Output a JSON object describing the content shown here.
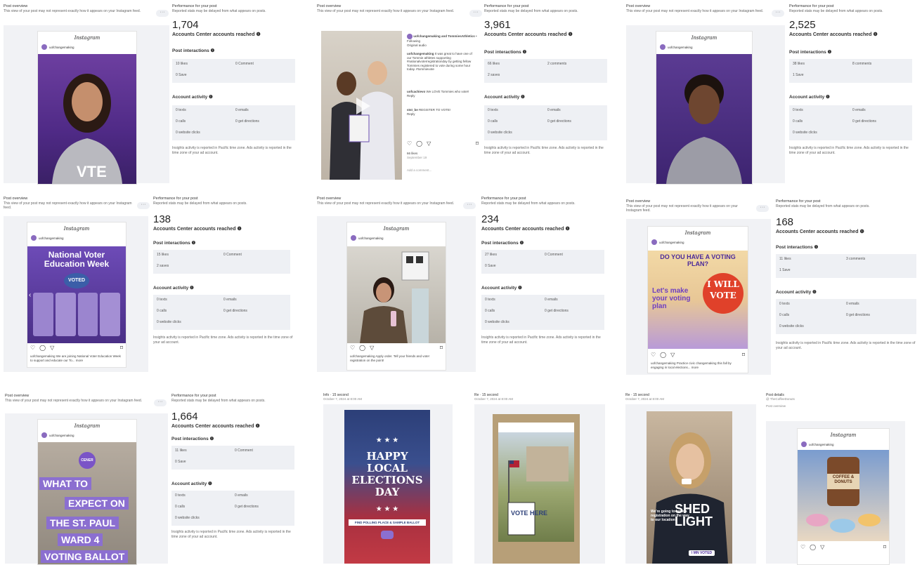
{
  "common": {
    "post_overview": "Post overview",
    "post_overview_note": "This view of your post may not represent exactly how it appears on your Instagram feed.",
    "perf_title": "Performance for your post",
    "perf_note": "Reported stats may be delayed from what appears on posts.",
    "reach_label": "Accounts Center accounts reached",
    "interactions_title": "Post interactions",
    "activity_title": "Account activity",
    "insights_note": "Insights activity is reported in Pacific time zone. Ads activity is reported in the time zone of your ad account.",
    "ig_logo": "Instagram",
    "username": "uofchangemaking",
    "menu_dots": "···",
    "icons": [
      "heart-icon",
      "comment-icon",
      "share-icon",
      "bookmark-icon",
      "info-icon"
    ]
  },
  "posts": [
    {
      "reached": "1,704",
      "likes": "10 likes",
      "comments": "0 Comment",
      "saves": "0 Save",
      "texts": "0 texts",
      "emails": "0 emails",
      "calls": "0 calls",
      "directions": "0 get directions",
      "website": "0 website clicks"
    },
    {
      "reached": "3,961",
      "likes": "66 likes",
      "comments": "2 comments",
      "saves": "2 saves",
      "texts": "0 texts",
      "emails": "0 emails",
      "calls": "0 calls",
      "directions": "0 get directions",
      "website": "0 website clicks",
      "comments_panel": {
        "header": "uofchangemaking and TommiesAthletics",
        "header_sub": "Original audio",
        "following": "• Following",
        "c1_user": "uofchangemaking",
        "c1_text": "It was great to have one of our Tommie athletes supporting #nationalvoterregistrationday by getting fellow Tommies registered to vote during some hour today. #tommievote",
        "c2_user": "uofcachievo",
        "c2_text": "We LOVE Tommies who vote!!",
        "c2_reply": "Reply",
        "c3_user": "stst_be",
        "c3_text": "REGISTER TO VOTE!",
        "c3_reply": "Reply",
        "likes": "66 likes",
        "date": "September 19",
        "add_comment": "Add a comment..."
      }
    },
    {
      "reached": "2,525",
      "likes": "38 likes",
      "comments": "8 comments",
      "saves": "1 Save",
      "texts": "0 texts",
      "emails": "0 emails",
      "calls": "0 calls",
      "directions": "0 get directions",
      "website": "0 website clicks"
    },
    {
      "reached": "138",
      "likes": "15 likes",
      "comments": "0 Comment",
      "saves": "2 saves",
      "texts": "0 texts",
      "emails": "0 emails",
      "calls": "0 calls",
      "directions": "0 get directions",
      "website": "0 website clicks",
      "headline": "National Voter Education Week",
      "badge": "VOTED",
      "caption": "uofchangemaking We are joining National Voter Education Week to support and educate our To... more"
    },
    {
      "reached": "234",
      "likes": "27 likes",
      "comments": "0 Comment",
      "saves": "0 Save",
      "texts": "0 texts",
      "emails": "0 emails",
      "calls": "0 calls",
      "directions": "0 get directions",
      "website": "0 website clicks",
      "caption": "uofchangemaking Apply order. Tell your friends and vote! registration on the point!"
    },
    {
      "reached": "168",
      "likes": "11 likes",
      "comments": "3 comments",
      "saves": "1 Save",
      "texts": "0 texts",
      "emails": "0 emails",
      "calls": "0 calls",
      "directions": "0 get directions",
      "website": "0 website clicks",
      "headline": "DO YOU HAVE A VOTING PLAN?",
      "subhead": "Let's make your voting plan",
      "button": "I WILL VOTE",
      "caption": "uofchangemaking Practice civic changemaking this fall by engaging in local elections... more"
    },
    {
      "reached": "1,664",
      "likes": "11 likes",
      "comments": "0 Comment",
      "saves": "0 Save",
      "texts": "0 texts",
      "emails": "0 emails",
      "calls": "0 calls",
      "directions": "0 get directions",
      "website": "0 website clicks",
      "lines": [
        "WHAT TO",
        "EXPECT ON",
        "THE ST. PAUL",
        "WARD 4",
        "VOTING BALLOT"
      ],
      "badge": "CENER"
    }
  ],
  "stories": [
    {
      "title": "Info · 15 second",
      "date": "October 7, 2024 at 8:00 AM",
      "headline": "HAPPY LOCAL ELECTIONS DAY",
      "bar": "FIND POLLING PLACE & SAMPLE BALLOT"
    },
    {
      "title": "Re · 15 second",
      "date": "October 7, 2024 at 8:00 AM",
      "headline": "VOTE HERE"
    },
    {
      "title": "Re · 15 second",
      "date": "October 7, 2024 at 8:00 AM",
      "headline": "SHED LIGHT",
      "sub": "We're going to have a registration on the way to our location",
      "bar": "I MN VOTED"
    },
    {
      "title": "Post details",
      "date": "@ TheCoffeeDonuts",
      "note": "Post overview",
      "headline": "COFFEE & DONUTS"
    }
  ]
}
